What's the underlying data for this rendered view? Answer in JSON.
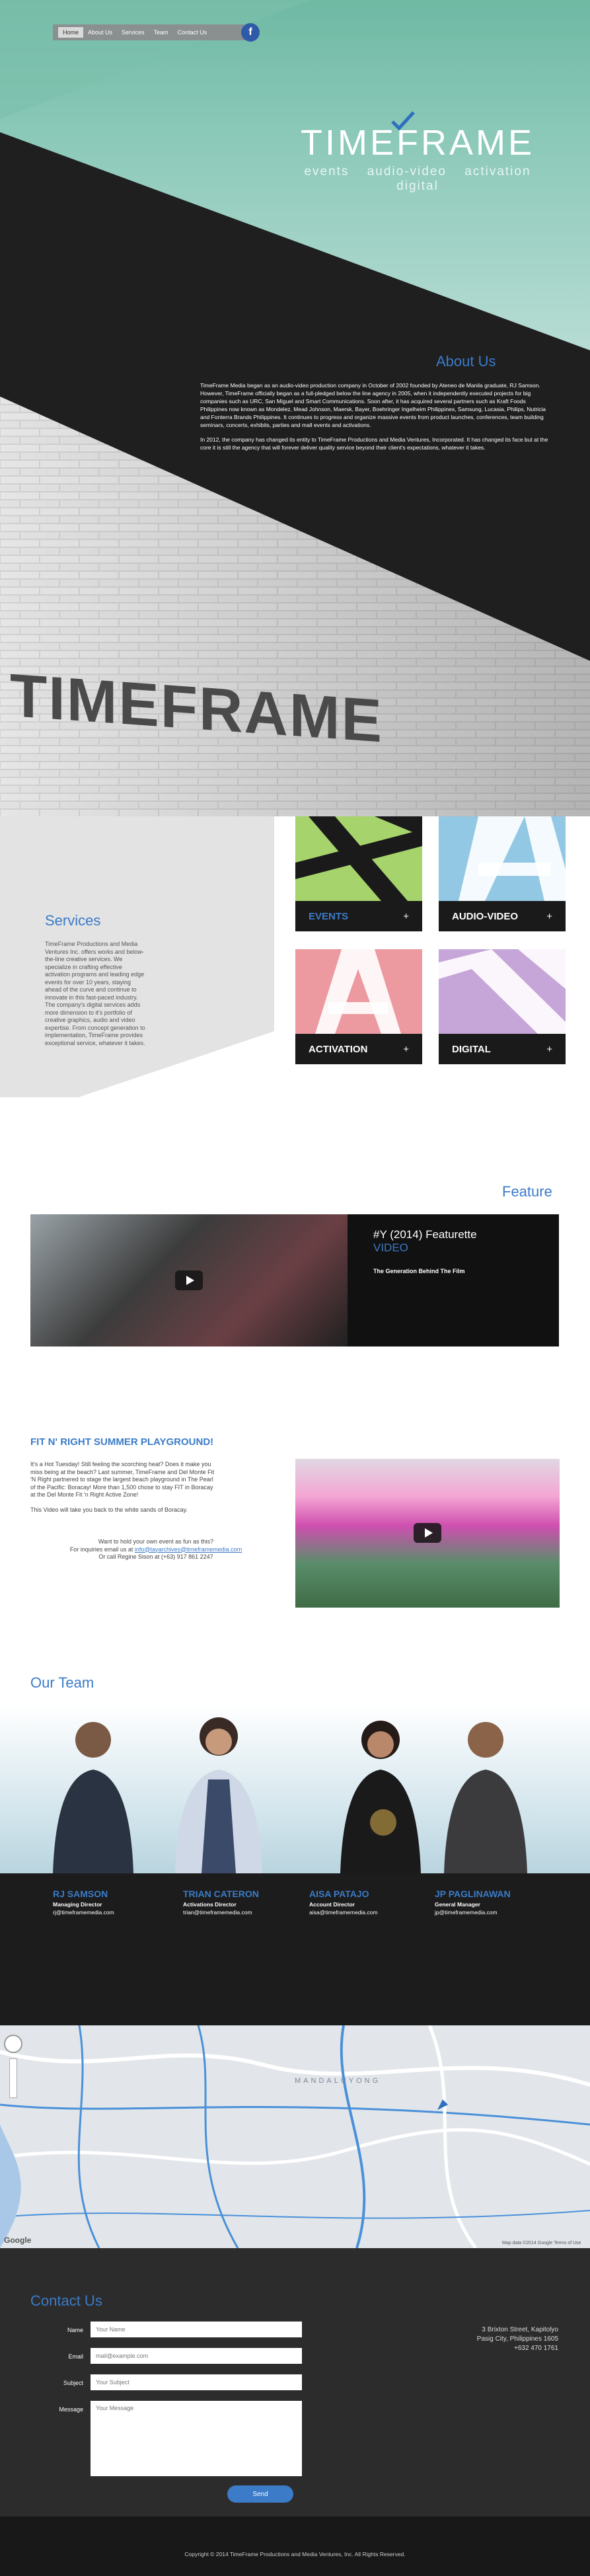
{
  "nav": {
    "items": [
      "Home",
      "About Us",
      "Services",
      "Team",
      "Contact Us"
    ],
    "facebook_icon": "f"
  },
  "hero": {
    "logo": "TIMEFRAME",
    "tagline": [
      "events",
      "audio-video",
      "activation",
      "digital"
    ]
  },
  "about": {
    "title": "About Us",
    "p1": "TimeFrame Media began as an audio-video production company in October of 2002 founded by Ateneo de Manila graduate, RJ Samson. However, TimeFrame officially began as a full-pledged below the line agency in 2005, when it independently executed projects for big companies such as URC, San Miguel and Smart Communications. Soon after, it has acquired several partners such as Kraft Foods Philippines now known as Mondelez, Mead Johnson, Maersk, Bayer, Boehringer Ingelheim Philippines, Samsung, Lucasia, Philips, Nutricia and Fonterra Brands Philippines. It continues to progress and organize massive events from product launches, conferences, team building seminars, concerts, exhibits, parties and mall events and activations.",
    "p2": "In 2012, the company has changed its entity to TimeFrame Productions and Media Ventures, Incorporated. It has changed its face but at the core it is still the agency that will forever deliver quality service beyond their client's expectations, whatever it takes."
  },
  "services": {
    "title": "Services",
    "text": "TimeFrame Productions and Media Ventures Inc. offers works and below-the-line creative services. We specialize in crafting effective activation programs and leading edge events for over 10 years, staying ahead of the curve and continue to innovate in this fast-paced industry. The company's digital services adds more dimension to it's portfolio of creative graphics, audio and video expertise. From concept generation to implementation, TimeFrame provides exceptional service, whatever it takes.",
    "tiles": [
      {
        "label": "EVENTS",
        "plus": "+"
      },
      {
        "label": "AUDIO-VIDEO",
        "plus": "+"
      },
      {
        "label": "ACTIVATION",
        "plus": "+"
      },
      {
        "label": "DIGITAL",
        "plus": "+"
      }
    ]
  },
  "feature": {
    "title": "Feature",
    "heading": "#Y (2014) Featurette",
    "heading2": "VIDEO",
    "sub": "The Generation Behind The Film"
  },
  "fit": {
    "title": "FIT N' RIGHT SUMMER PLAYGROUND!",
    "p1": "It's a Hot Tuesday! Still feeling the scorching heat? Does it make you miss being at the beach? Last summer, TimeFrame and Del Monte Fit 'N Right partnered to stage the largest beach playground in The Pearl of the Pacific: Boracay! More than 1,500 chose to stay FIT in Boracay at the Del Monte Fit 'n Right Active Zone!",
    "p2": "This Video will take you back to the white sands of Boracay.",
    "c1": "Want to hold your own event as fun as this?",
    "c2_prefix": "For inquiries email us at ",
    "c2_email": "info@tayarchives@timeframemedia.com",
    "c3": "Or call Regine Sison at (+63) 917 861 2247"
  },
  "team": {
    "title": "Our Team",
    "members": [
      {
        "name": "RJ SAMSON",
        "role": "Managing Director",
        "email": "rj@timeframemedia.com"
      },
      {
        "name": "TRIAN CATERON",
        "role": "Activations Director",
        "email": "trian@timeframemedia.com"
      },
      {
        "name": "AISA PATAJO",
        "role": "Account Director",
        "email": "aisa@timeframemedia.com"
      },
      {
        "name": "JP PAGLINAWAN",
        "role": "General Manager",
        "email": "jp@timeframemedia.com"
      }
    ]
  },
  "map": {
    "label": "MANDALUYONG",
    "google": "Google",
    "attribution": "Map data ©2014 Google  Terms of Use"
  },
  "contact": {
    "title": "Contact Us",
    "fields": [
      {
        "label": "Name",
        "placeholder": "Your Name"
      },
      {
        "label": "Email",
        "placeholder": "mail@example.com"
      },
      {
        "label": "Subject",
        "placeholder": "Your Subject"
      },
      {
        "label": "Message",
        "placeholder": "Your Message"
      }
    ],
    "send": "Send",
    "address": [
      "3 Brixton Street, Kapitolyo",
      "Pasig City, Philippines 1605",
      "+632 470 1761"
    ]
  },
  "footer": {
    "copyright": "Copyright © 2014 TimeFrame Productions and Media Ventures, Inc. All Rights Reserved."
  },
  "colors": {
    "accent": "#3b7bc8",
    "events": "#a6d36b",
    "audio_video": "#93c8e4",
    "activation": "#ec9a9f",
    "digital": "#c6a6d8"
  }
}
